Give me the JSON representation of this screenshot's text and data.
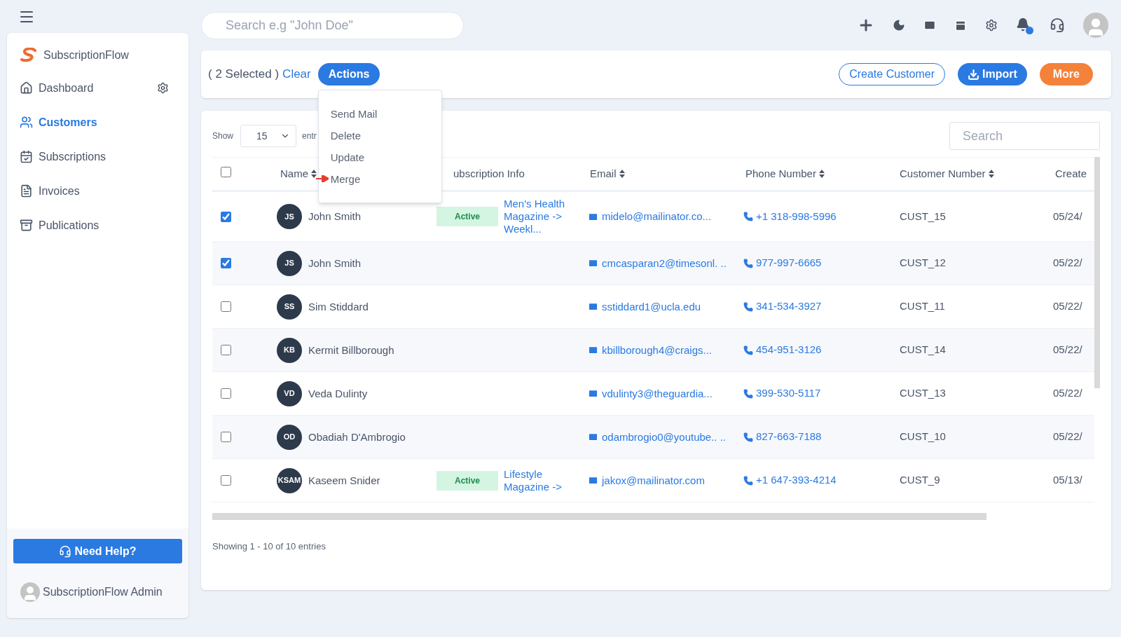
{
  "top_bar": {
    "search": {
      "placeholder": "Search e.g \"John Doe\""
    },
    "notification_dot": true
  },
  "sidebar": {
    "brand": "SubscriptionFlow",
    "items": [
      {
        "label": "Dashboard",
        "kind": "dashboard",
        "selected": false,
        "has_settings": true
      },
      {
        "label": "Customers",
        "kind": "customers",
        "selected": true,
        "has_settings": false
      },
      {
        "label": "Subscriptions",
        "kind": "subscriptions",
        "selected": false,
        "has_settings": false
      },
      {
        "label": "Invoices",
        "kind": "invoices",
        "selected": false,
        "has_settings": false
      },
      {
        "label": "Publications",
        "kind": "publications",
        "selected": false,
        "has_settings": false
      }
    ],
    "help_button": "Need Help?",
    "user": "SubscriptionFlow Admin"
  },
  "toolbar": {
    "selection": "( 2 Selected )",
    "clear": "Clear",
    "actions": "Actions",
    "actions_menu": {
      "expanded": true,
      "items": [
        {
          "label": "Send Mail",
          "pointed": false
        },
        {
          "label": "Delete",
          "pointed": false
        },
        {
          "label": "Update",
          "pointed": false
        },
        {
          "label": "Merge",
          "pointed": true
        }
      ]
    },
    "buttons": [
      {
        "label": "Create Customer",
        "kind": "outline"
      },
      {
        "label": "Import",
        "kind": "import"
      },
      {
        "label": "More",
        "kind": "orange"
      }
    ]
  },
  "table_controls": {
    "show_label": "Show",
    "page_size": "15",
    "entries_label": "entr",
    "search": {
      "placeholder": "Search"
    }
  },
  "table": {
    "select_all": false,
    "columns": [
      {
        "label": "Name",
        "sortable": true
      },
      {
        "label": "ubscription Info",
        "sortable": false
      },
      {
        "label": "Email",
        "sortable": true
      },
      {
        "label": "Phone Number",
        "sortable": true
      },
      {
        "label": "Customer Number",
        "sortable": true
      },
      {
        "label": "Create"
      }
    ],
    "rows": [
      {
        "selected": true,
        "initials": "JS",
        "name": "John Smith",
        "status": "Active",
        "subscription": "Men's Health Magazine -> Weekl...",
        "email": "midelo@mailinator.co...",
        "phone": "+1 318-998-5996",
        "customer_number": "CUST_15",
        "created": "05/24/"
      },
      {
        "selected": true,
        "initials": "JS",
        "name": "John Smith",
        "email": "cmcasparan2@timesonl. ..",
        "phone": "977-997-6665",
        "customer_number": "CUST_12",
        "created": "05/22/"
      },
      {
        "selected": false,
        "initials": "SS",
        "name": "Sim Stiddard",
        "email": "sstiddard1@ucla.edu",
        "phone": "341-534-3927",
        "customer_number": "CUST_11",
        "created": "05/22/"
      },
      {
        "selected": false,
        "initials": "KB",
        "name": "Kermit Billborough",
        "email": "kbillborough4@craigs...",
        "phone": "454-951-3126",
        "customer_number": "CUST_14",
        "created": "05/22/"
      },
      {
        "selected": false,
        "initials": "VD",
        "name": "Veda Dulinty",
        "email": "vdulinty3@theguardia...",
        "phone": "399-530-5117",
        "customer_number": "CUST_13",
        "created": "05/22/"
      },
      {
        "selected": false,
        "initials": "OD",
        "name": "Obadiah D'Ambrogio",
        "email": "odambrogio0@youtube.. ..",
        "phone": "827-663-7188",
        "customer_number": "CUST_10",
        "created": "05/22/"
      },
      {
        "selected": false,
        "initials": "KSAM",
        "name": "Kaseem Snider",
        "status": "Active",
        "subscription": "Lifestyle Magazine ->",
        "email": "jakox@mailinator.com",
        "phone": "+1 647-393-4214",
        "customer_number": "CUST_9",
        "created": "05/13/"
      }
    ]
  },
  "footer": "Showing 1 - 10 of 10 entries"
}
